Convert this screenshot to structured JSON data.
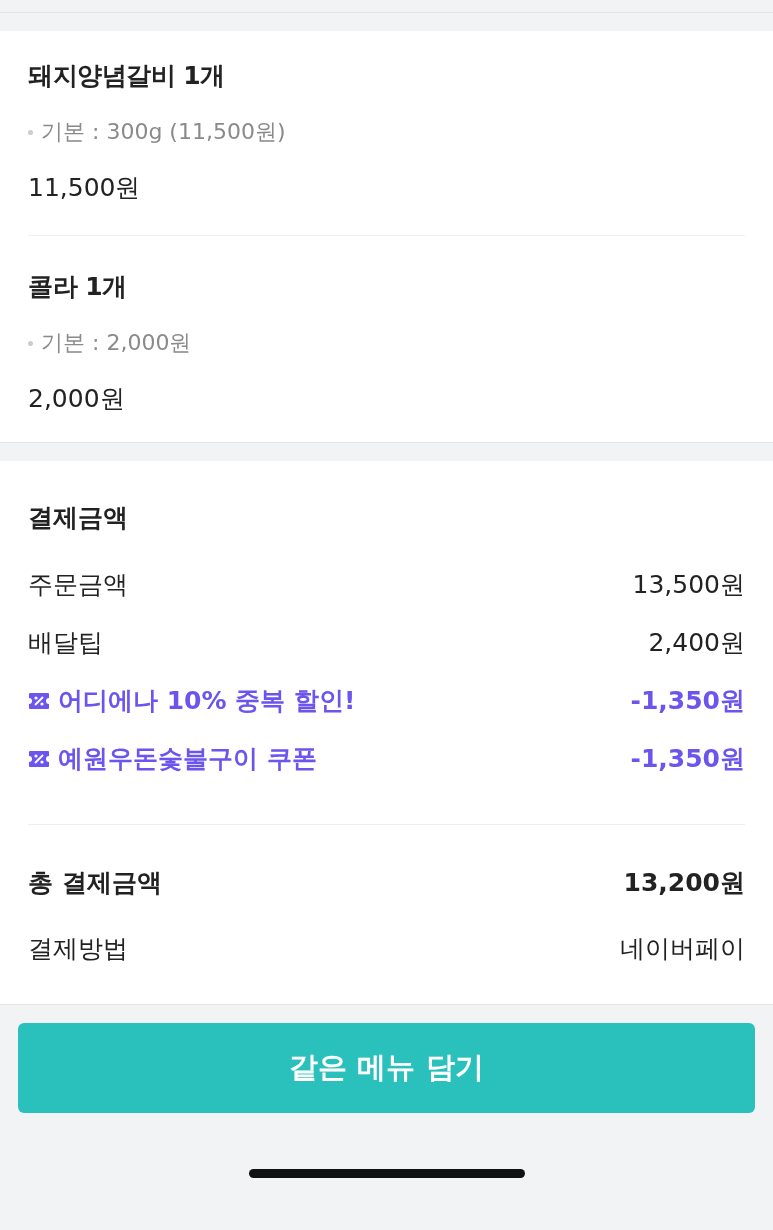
{
  "items": [
    {
      "name": "돼지양념갈비 1개",
      "option": "기본 : 300g (11,500원)",
      "price": "11,500원"
    },
    {
      "name": "콜라 1개",
      "option": "기본 : 2,000원",
      "price": "2,000원"
    }
  ],
  "payment": {
    "title": "결제금액",
    "rows": [
      {
        "kind": "plain",
        "label": "주문금액",
        "value": "13,500원"
      },
      {
        "kind": "plain",
        "label": "배달팁",
        "value": "2,400원"
      },
      {
        "kind": "coupon",
        "label": "어디에나 10% 중복 할인!",
        "value": "-1,350원"
      },
      {
        "kind": "coupon",
        "label": "예원우돈숯불구이 쿠폰",
        "value": "-1,350원"
      }
    ],
    "summary": [
      {
        "kind": "total",
        "label": "총 결제금액",
        "value": "13,200원"
      },
      {
        "kind": "plain",
        "label": "결제방법",
        "value": "네이버페이"
      }
    ]
  },
  "button": "같은 메뉴 담기"
}
